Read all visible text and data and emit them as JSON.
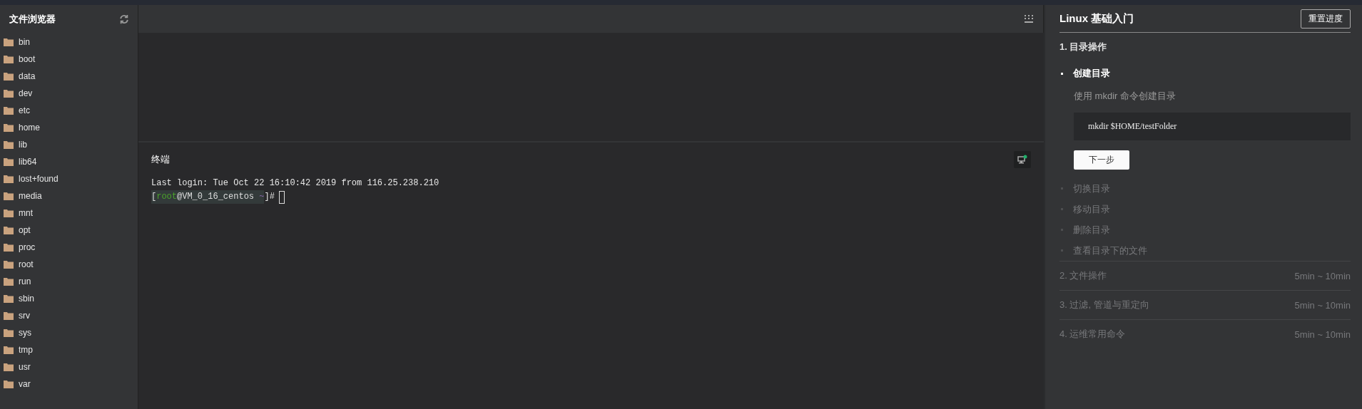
{
  "file_browser": {
    "title": "文件浏览器",
    "folders": [
      "bin",
      "boot",
      "data",
      "dev",
      "etc",
      "home",
      "lib",
      "lib64",
      "lost+found",
      "media",
      "mnt",
      "opt",
      "proc",
      "root",
      "run",
      "sbin",
      "srv",
      "sys",
      "tmp",
      "usr",
      "var"
    ]
  },
  "terminal": {
    "title": "终端",
    "connected": true,
    "login_line": "Last login: Tue Oct 22 16:10:42 2019 from 116.25.238.210",
    "prompt": {
      "open": "[",
      "user": "root",
      "host": "@VM_0_16_centos",
      "path": "~",
      "close": "]#"
    }
  },
  "tutorial": {
    "title": "Linux 基础入门",
    "reset_button": "重置进度",
    "sections": [
      {
        "number": "1.",
        "title": "目录操作",
        "disabled": false,
        "lessons": [
          {
            "title": "创建目录",
            "active": true,
            "description": "使用 mkdir 命令创建目录",
            "command": "mkdir $HOME/testFolder",
            "next_button": "下一步"
          },
          {
            "title": "切换目录",
            "active": false
          },
          {
            "title": "移动目录",
            "active": false
          },
          {
            "title": "删除目录",
            "active": false
          },
          {
            "title": "查看目录下的文件",
            "active": false
          }
        ]
      },
      {
        "number": "2.",
        "title": "文件操作",
        "duration": "5min ~ 10min",
        "disabled": true
      },
      {
        "number": "3.",
        "title": "过滤, 管道与重定向",
        "duration": "5min ~ 10min",
        "disabled": true
      },
      {
        "number": "4.",
        "title": "运维常用命令",
        "duration": "5min ~ 10min",
        "disabled": true
      }
    ]
  }
}
